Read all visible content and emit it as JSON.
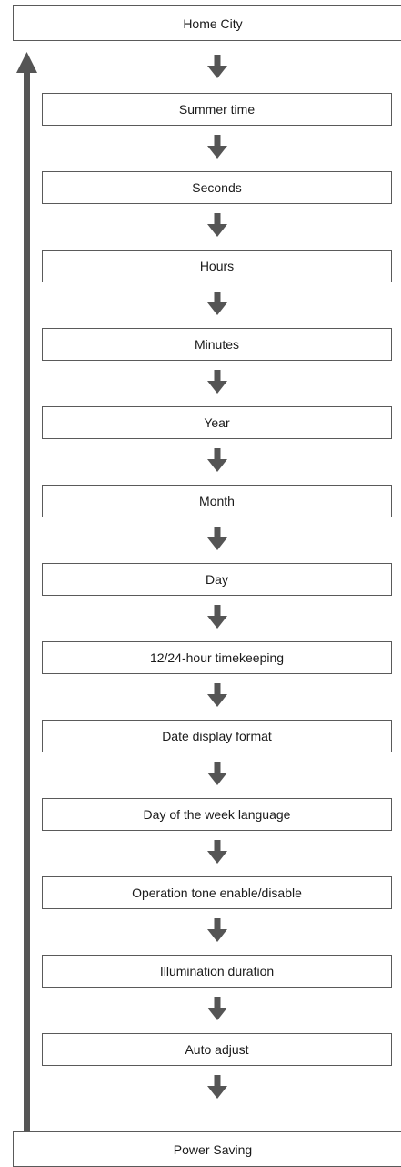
{
  "flow": {
    "start": "Home City",
    "steps": [
      "Summer time",
      "Seconds",
      "Hours",
      "Minutes",
      "Year",
      "Month",
      "Day",
      "12/24-hour timekeeping",
      "Date display format",
      "Day of the week language",
      "Operation tone enable/disable",
      "Illumination duration",
      "Auto adjust"
    ],
    "end": "Power Saving"
  },
  "icons": {
    "step_arrow": "arrow-down-icon",
    "loop_arrow": "arrow-up-icon"
  },
  "colors": {
    "arrow": "#555555",
    "box_border": "#5a5a5a",
    "text": "#1a1a1a"
  }
}
